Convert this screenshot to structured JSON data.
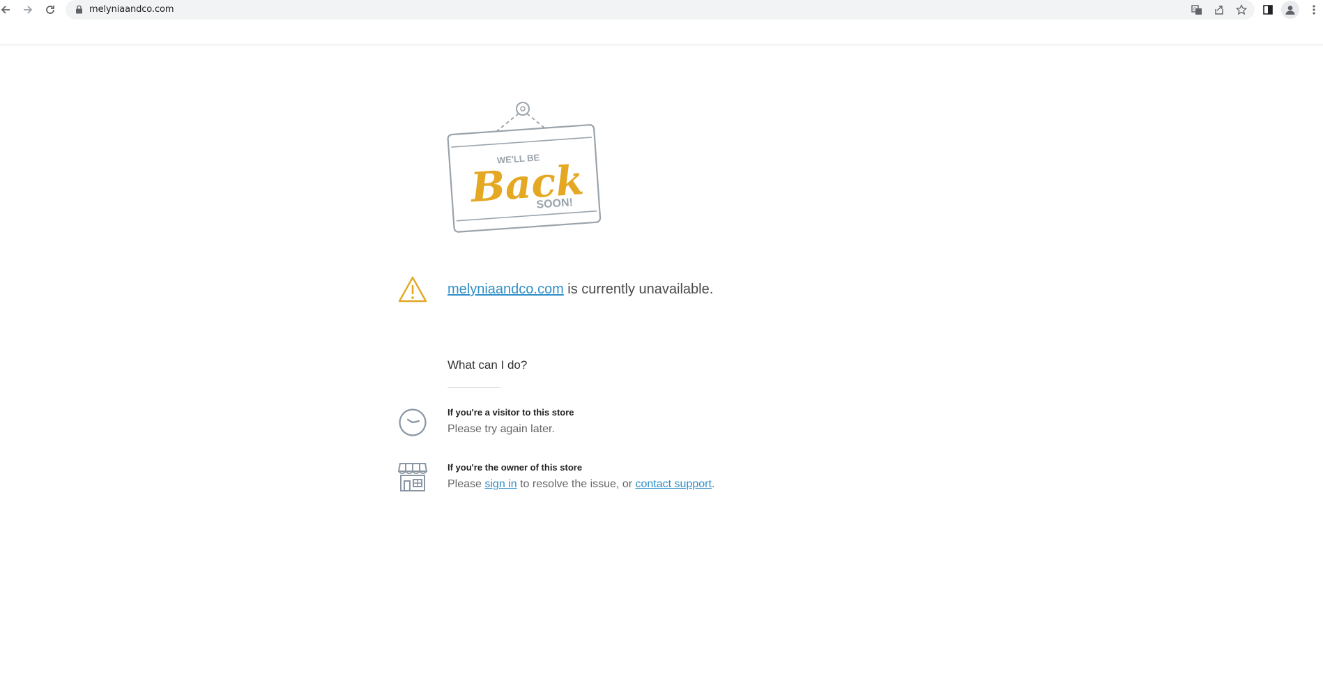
{
  "browser": {
    "url": "melyniaandco.com",
    "icons": [
      "back-icon",
      "forward-icon",
      "reload-icon",
      "lock-icon",
      "translate-icon",
      "share-icon",
      "bookmark-star-icon",
      "side-panel-icon",
      "profile-icon",
      "menu-kebab-icon"
    ]
  },
  "page": {
    "illustration": {
      "line1": "WE'LL BE",
      "line2": "Back",
      "line3": "SOON!"
    },
    "headline": {
      "link": "melyniaandco.com",
      "text": " is currently unavailable."
    },
    "what_title": "What can I do?",
    "visitor": {
      "heading": "If you're a visitor to this store",
      "text": "Please try again later."
    },
    "owner": {
      "heading": "If you're the owner of this store",
      "text_before": "Please ",
      "sign_in": "sign in",
      "text_middle": " to resolve the issue, or ",
      "contact": "contact support",
      "text_after": "."
    },
    "colors": {
      "accent": "#e4a822",
      "link": "#2f8fc7",
      "icon_gray": "#8a96a3"
    }
  }
}
